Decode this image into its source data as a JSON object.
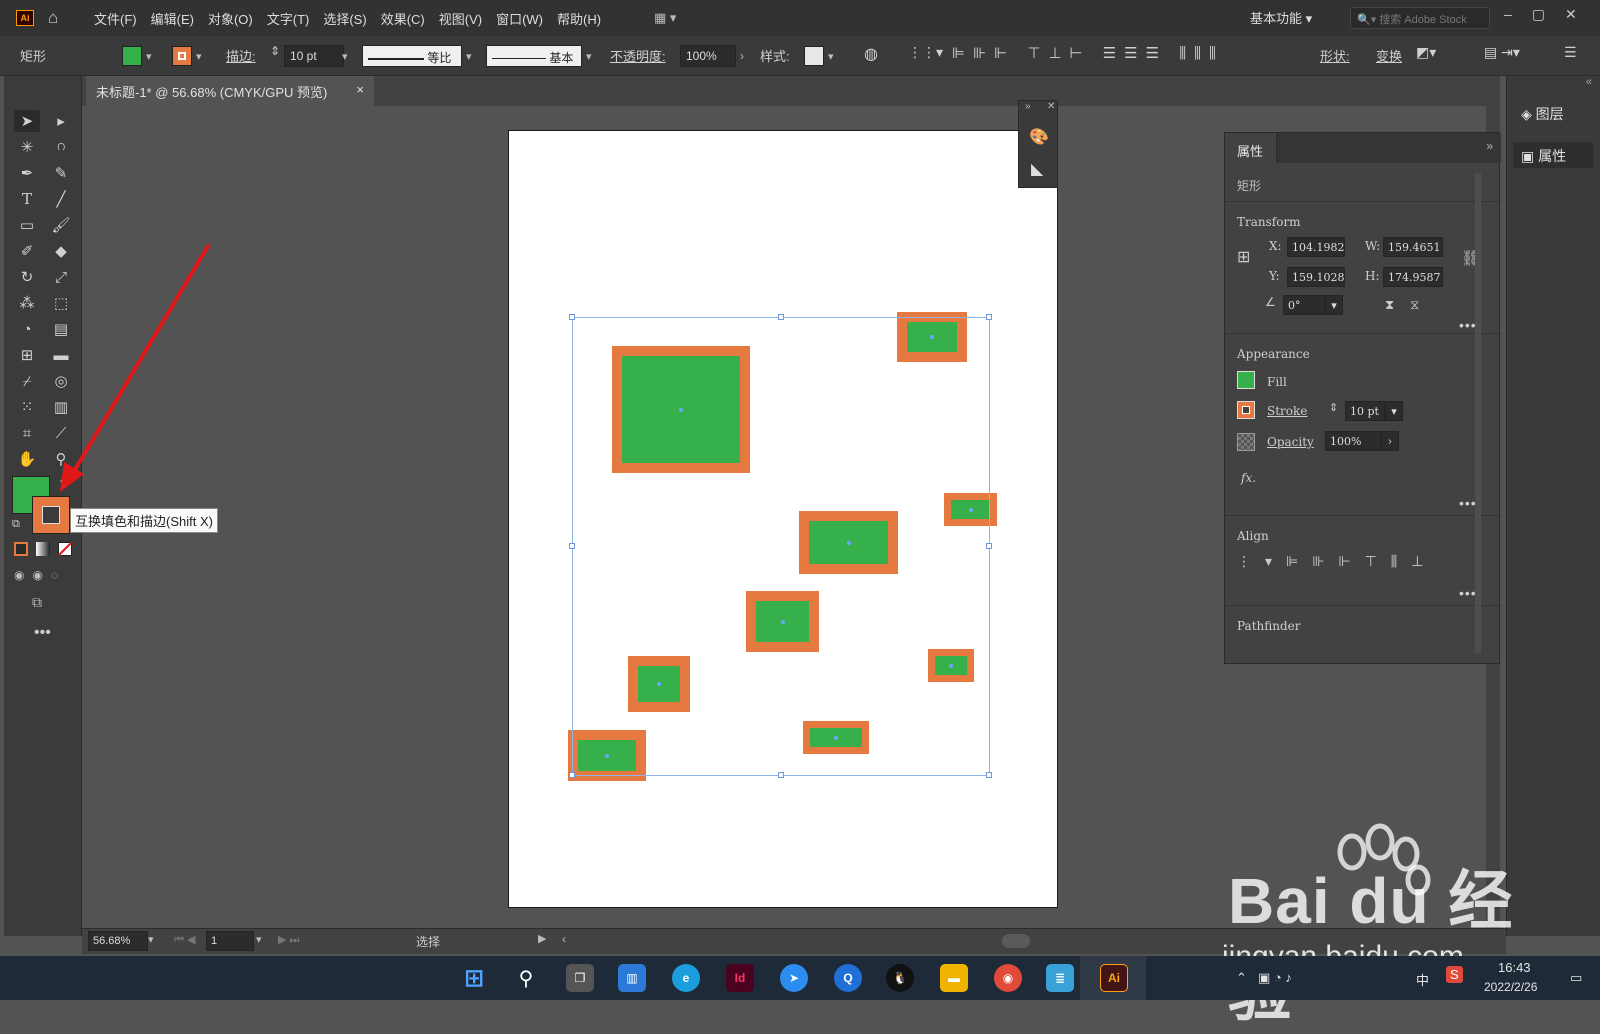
{
  "app": {
    "logo_text": "Ai"
  },
  "menu": [
    "文件(F)",
    "编辑(E)",
    "对象(O)",
    "文字(T)",
    "选择(S)",
    "效果(C)",
    "视图(V)",
    "窗口(W)",
    "帮助(H)"
  ],
  "workspace": "基本功能",
  "search_placeholder": "搜索 Adobe Stock",
  "control": {
    "object_type": "矩形",
    "stroke_label": "描边:",
    "stroke_weight": "10 pt",
    "profile_label": "等比",
    "brush_label": "基本",
    "opacity_label": "不透明度:",
    "opacity_value": "100%",
    "style_label": "样式:",
    "shape_label": "形状:",
    "transform_label": "变换"
  },
  "document_tab": {
    "title": "未标题-1* @ 56.68% (CMYK/GPU 预览)",
    "close": "×"
  },
  "tooltip": "互换填色和描边(Shift X)",
  "properties": {
    "tab": "属性",
    "object": "矩形",
    "transform_title": "Transform",
    "x_label": "X:",
    "x_value": "104.1982",
    "y_label": "Y:",
    "y_value": "159.1028",
    "w_label": "W:",
    "w_value": "159.4651",
    "h_label": "H:",
    "h_value": "174.9587",
    "angle_value": "0°",
    "appearance_title": "Appearance",
    "fill_label": "Fill",
    "stroke_label": "Stroke",
    "stroke_value": "10 pt",
    "opacity_label": "Opacity",
    "opacity_value": "100%",
    "fx_label": "fx.",
    "align_title": "Align",
    "pathfinder_title": "Pathfinder"
  },
  "dock": {
    "layers": "图层",
    "properties": "属性"
  },
  "status": {
    "zoom": "56.68%",
    "artboard": "1",
    "tool": "选择"
  },
  "taskbar": {
    "time": "16:43",
    "date": "2022/2/26",
    "ime": "中"
  },
  "watermark": {
    "brand": "Bai du 经验",
    "url": "jingyan.baidu.com"
  },
  "colors": {
    "fill": "#35b04a",
    "stroke": "#e6793f",
    "accent": "#e01818"
  }
}
